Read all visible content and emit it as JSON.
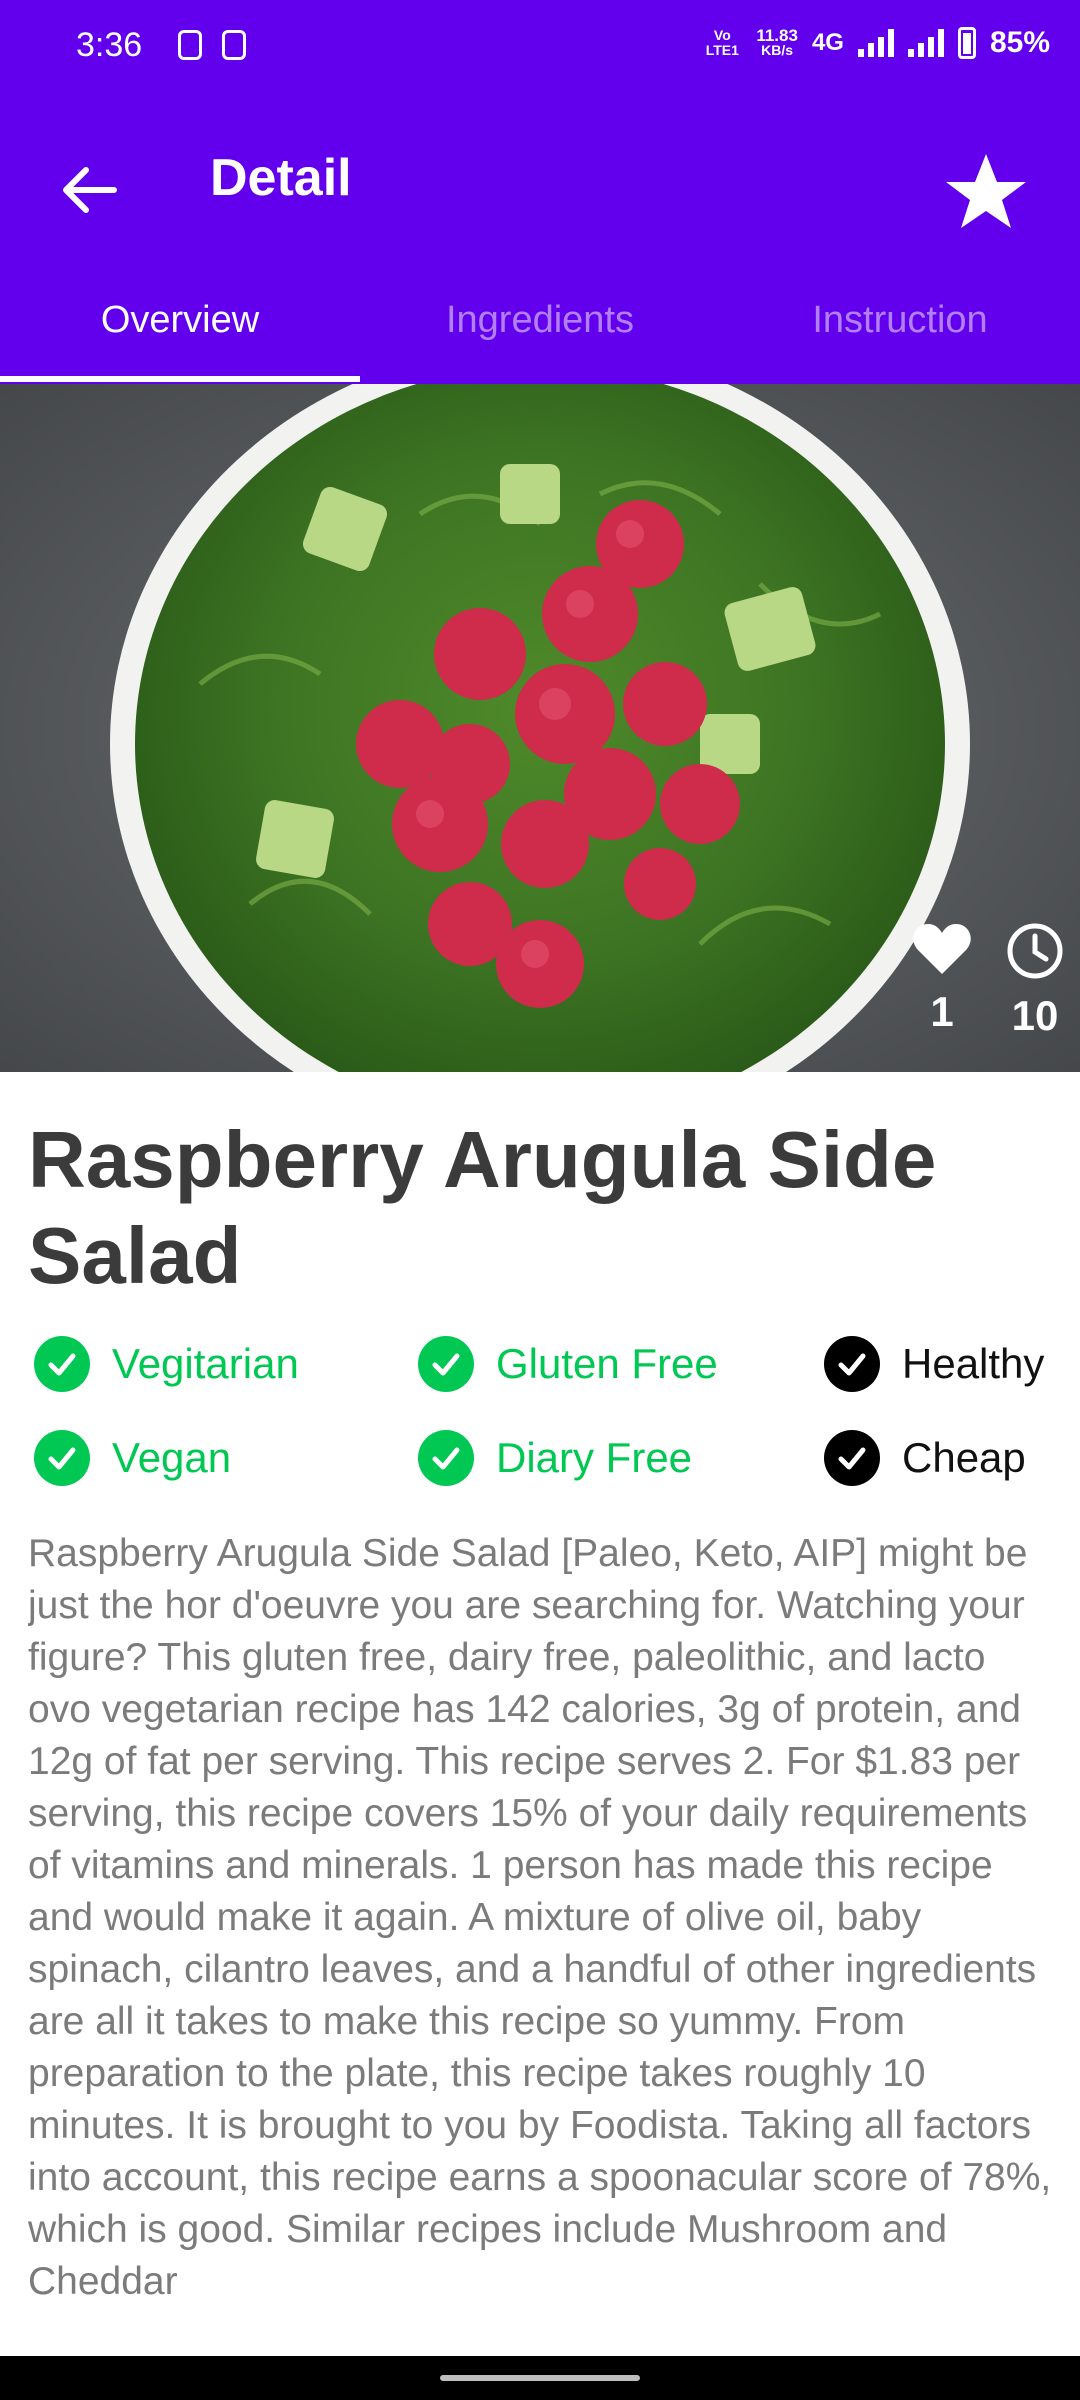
{
  "status_bar": {
    "time": "3:36",
    "volte": "Vo LTE1",
    "net_speed": "11.83",
    "net_unit": "KB/s",
    "network": "4G",
    "battery": "85%"
  },
  "app_bar": {
    "title": "Detail",
    "back_icon": "arrow-left-icon",
    "favorite_icon": "star-icon"
  },
  "tabs": [
    {
      "label": "Overview",
      "selected": true
    },
    {
      "label": "Ingredients",
      "selected": false
    },
    {
      "label": "Instruction",
      "selected": false
    }
  ],
  "hero": {
    "likes": "1",
    "minutes": "10"
  },
  "recipe": {
    "title": "Raspberry Arugula Side Salad",
    "badges": [
      {
        "label": "Vegitarian",
        "state": "on"
      },
      {
        "label": "Gluten Free",
        "state": "on"
      },
      {
        "label": "Healthy",
        "state": "off"
      },
      {
        "label": "Vegan",
        "state": "on"
      },
      {
        "label": "Diary Free",
        "state": "on"
      },
      {
        "label": "Cheap",
        "state": "off"
      }
    ],
    "summary": "Raspberry Arugula Side Salad [Paleo, Keto, AIP] might be just the hor d'oeuvre you are searching for. Watching your figure? This gluten free, dairy free, paleolithic, and lacto ovo vegetarian recipe has 142 calories, 3g of protein, and 12g of fat per serving. This recipe serves 2. For $1.83 per serving, this recipe covers 15% of your daily requirements of vitamins and minerals. 1 person has made this recipe and would make it again. A mixture of olive oil, baby spinach, cilantro leaves, and a handful of other ingredients are all it takes to make this recipe so yummy. From preparation to the plate, this recipe takes roughly 10 minutes. It is brought to you by Foodista. Taking all factors into account, this recipe earns a spoonacular score of 78%, which is good. Similar recipes include Mushroom and Cheddar"
  },
  "colors": {
    "primary": "#6200EE",
    "badge_green": "#00C853",
    "text_dark": "#3b3b3b",
    "text_body": "#7b7b7b"
  }
}
